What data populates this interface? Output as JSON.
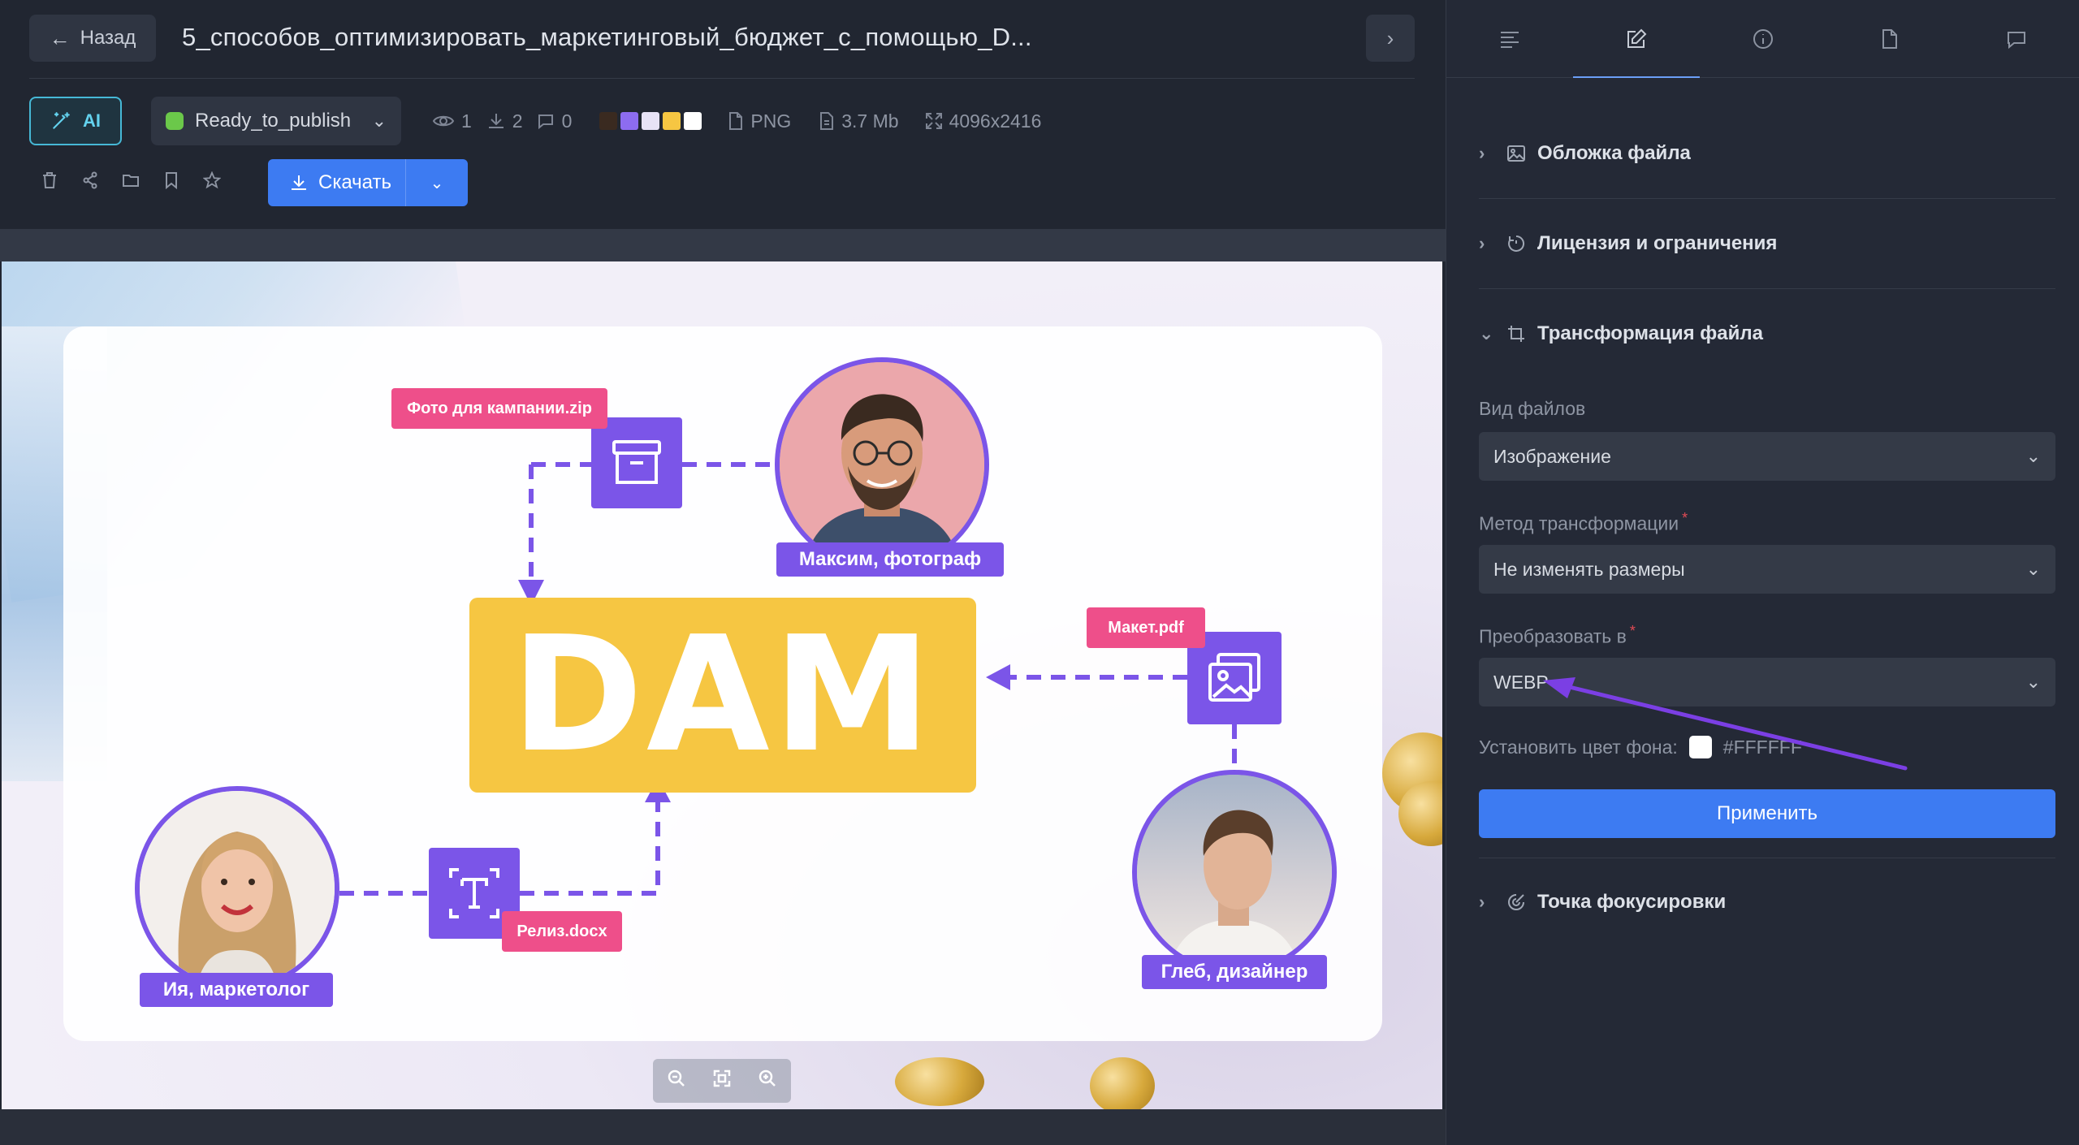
{
  "header": {
    "back_label": "Назад",
    "file_title": "5_способов_оптимизировать_маркетинговый_бюджет_с_помощью_D..."
  },
  "toolbar": {
    "ai_label": "AI",
    "status": {
      "value": "Ready_to_publish",
      "color": "#6bc84a"
    },
    "views": "1",
    "downloads": "2",
    "comments": "0",
    "palette": [
      "#3a2a20",
      "#8d6cf0",
      "#e7e2f6",
      "#f6c642",
      "#ffffff"
    ],
    "format": "PNG",
    "size": "3.7 Mb",
    "dimensions": "4096x2416",
    "download_label": "Скачать"
  },
  "preview": {
    "center_text": "DAM",
    "people": [
      {
        "name": "Максим, фотограф"
      },
      {
        "name": "Ия, маркетолог"
      },
      {
        "name": "Глеб, дизайнер"
      }
    ],
    "files": [
      "Фото для кампании.zip",
      "Макет.pdf",
      "Релиз.docx"
    ]
  },
  "sidebar": {
    "tabs": [
      "details",
      "edit",
      "info",
      "file",
      "comments"
    ],
    "active_tab": "edit",
    "sections": {
      "cover": "Обложка файла",
      "license": "Лицензия и ограничения",
      "transform": "Трансформация файла",
      "focus": "Точка фокусировки"
    },
    "form": {
      "file_type_label": "Вид файлов",
      "file_type_value": "Изображение",
      "method_label": "Метод трансформации",
      "method_value": "Не изменять размеры",
      "convert_label": "Преобразовать в",
      "convert_value": "WEBP",
      "bg_label": "Установить цвет фона:",
      "bg_value": "#FFFFFF",
      "apply_label": "Применить",
      "required_mark": "*"
    }
  },
  "colors": {
    "accent": "#3d7bf2",
    "purple": "#7b55e8",
    "pink": "#ee4f8a",
    "yellow": "#f6c642"
  }
}
